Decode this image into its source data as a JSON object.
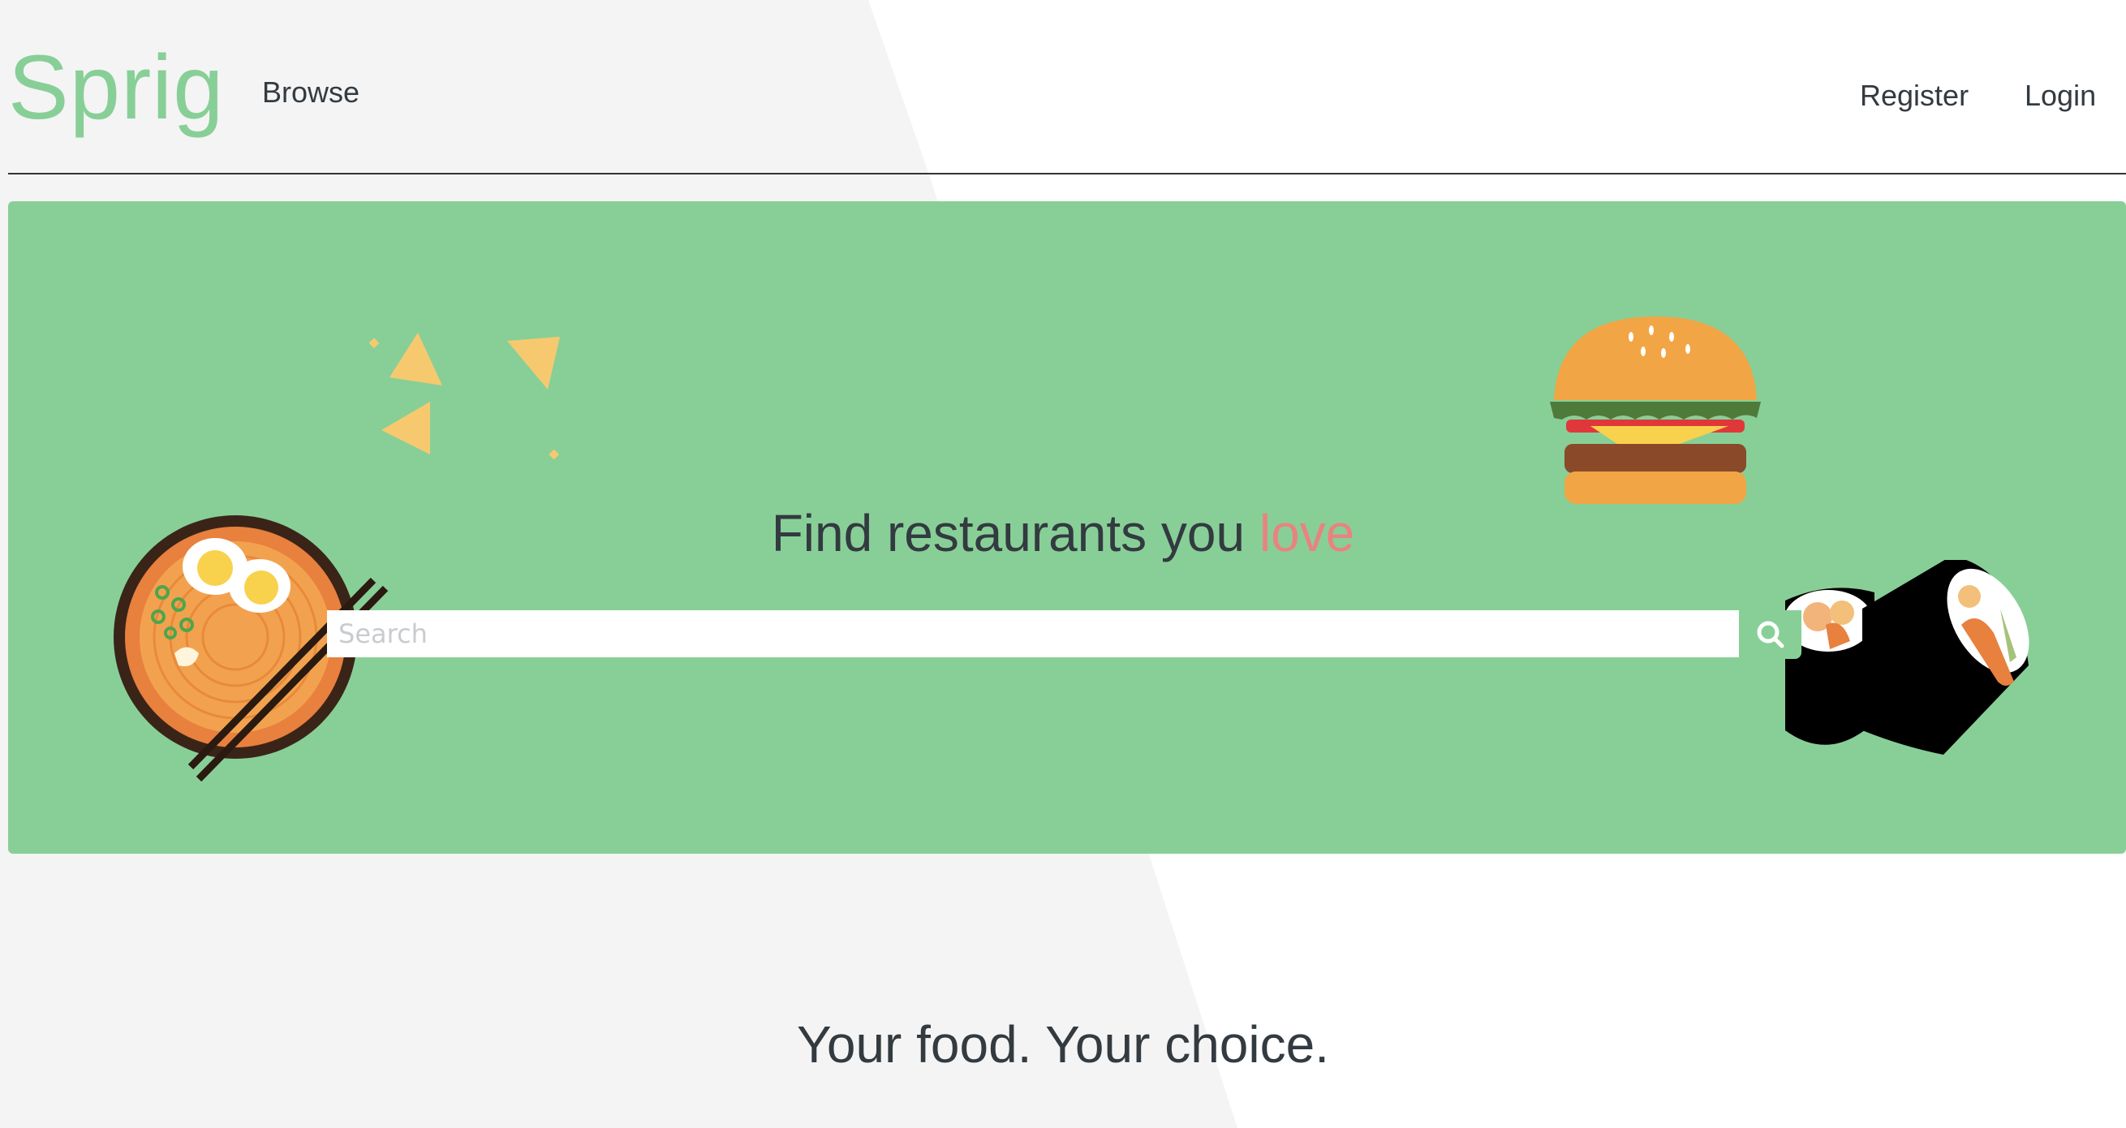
{
  "header": {
    "logo": "Sprig",
    "nav_left": [
      {
        "label": "Browse"
      }
    ],
    "nav_right": [
      {
        "label": "Register"
      },
      {
        "label": "Login"
      }
    ]
  },
  "hero": {
    "headline_prefix": "Find restaurants you ",
    "headline_highlight": "love",
    "search": {
      "placeholder": "Search",
      "value": "",
      "button_icon": "search-icon"
    },
    "illustrations": [
      "ramen-bowl-icon",
      "chips-icon",
      "burger-icon",
      "sushi-roll-icon"
    ]
  },
  "section": {
    "title": "Your food. Your choice."
  },
  "colors": {
    "brand": "#88cf97",
    "highlight": "#e9837f",
    "text": "#333a40",
    "background_shape": "#f4f4f4"
  }
}
